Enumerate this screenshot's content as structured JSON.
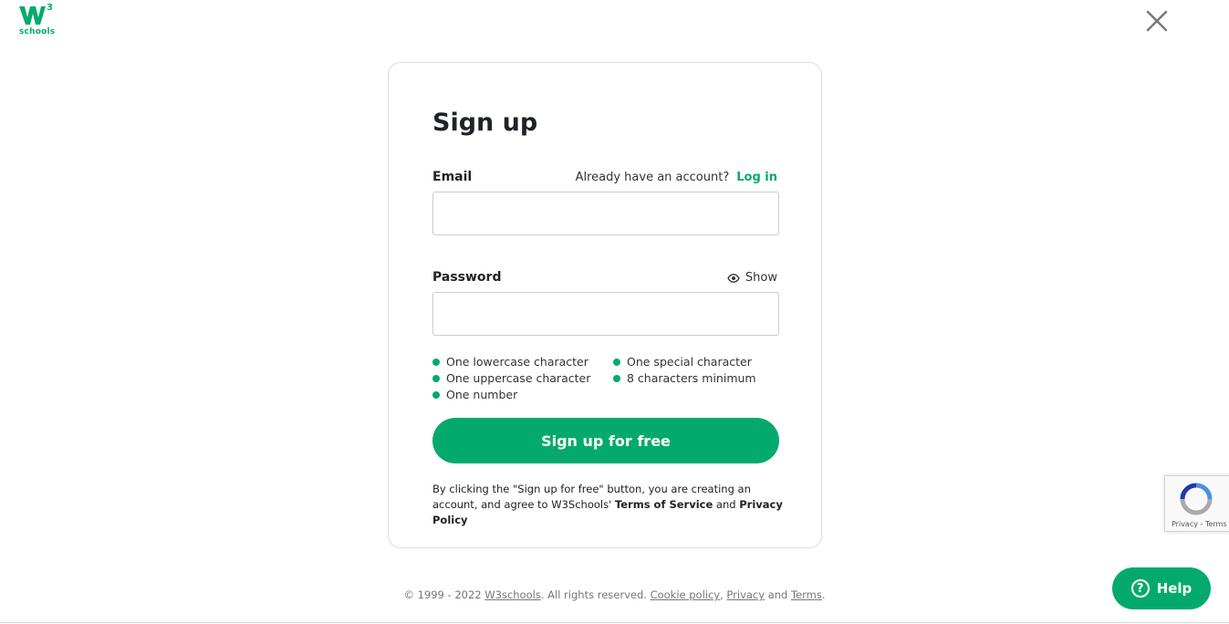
{
  "logo": {
    "superscript": "3",
    "word": "schools",
    "icon": "w3schools-logo-icon"
  },
  "close": {
    "icon": "close-icon"
  },
  "form": {
    "title": "Sign up",
    "email_label": "Email",
    "already_text": "Already have an account?",
    "login_link": "Log in",
    "email_value": "",
    "password_label": "Password",
    "show_label": "Show",
    "password_value": "",
    "requirements": [
      "One lowercase character",
      "One special character",
      "One uppercase character",
      "8 characters minimum",
      "One number"
    ],
    "submit_label": "Sign up for free",
    "legal_prefix": "By clicking the \"Sign up for free\" button, you are creating an account, and agree to W3Schools'",
    "terms_link": "Terms of Service",
    "legal_and": "and",
    "privacy_link": "Privacy Policy"
  },
  "footer": {
    "copyright": "© 1999 - 2022",
    "brand_link": "W3schools",
    "rights": ". All rights reserved.",
    "cookie_link": "Cookie policy",
    "comma": ",",
    "privacy_link": "Privacy",
    "and": "and",
    "terms_link": "Terms",
    "period": "."
  },
  "recaptcha": {
    "links": "Privacy - Terms"
  },
  "help": {
    "label": "Help",
    "icon_glyph": "?"
  },
  "colors": {
    "accent": "#04aa6d",
    "text": "#222222",
    "border": "#dddddd"
  }
}
